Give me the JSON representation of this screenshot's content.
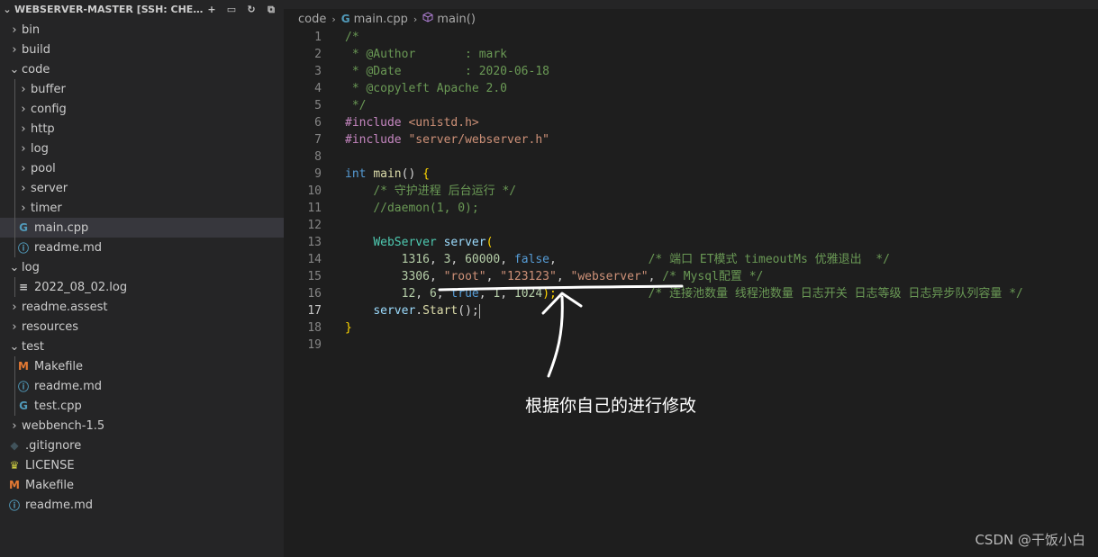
{
  "explorer": {
    "title": "WEBSERVER-MASTER [SSH: CHEN-VI...",
    "actions": [
      {
        "name": "new-file-icon",
        "glyph": "+"
      },
      {
        "name": "new-folder-icon",
        "glyph": "▭"
      },
      {
        "name": "refresh-icon",
        "glyph": "↻"
      },
      {
        "name": "collapse-all-icon",
        "glyph": "⧉"
      }
    ],
    "tree": [
      {
        "label": "bin",
        "type": "folder",
        "depth": 0,
        "expanded": false
      },
      {
        "label": "build",
        "type": "folder",
        "depth": 0,
        "expanded": false
      },
      {
        "label": "code",
        "type": "folder",
        "depth": 0,
        "expanded": true
      },
      {
        "label": "buffer",
        "type": "folder",
        "depth": 1,
        "expanded": false
      },
      {
        "label": "config",
        "type": "folder",
        "depth": 1,
        "expanded": false
      },
      {
        "label": "http",
        "type": "folder",
        "depth": 1,
        "expanded": false
      },
      {
        "label": "log",
        "type": "folder",
        "depth": 1,
        "expanded": false
      },
      {
        "label": "pool",
        "type": "folder",
        "depth": 1,
        "expanded": false
      },
      {
        "label": "server",
        "type": "folder",
        "depth": 1,
        "expanded": false
      },
      {
        "label": "timer",
        "type": "folder",
        "depth": 1,
        "expanded": false
      },
      {
        "label": "main.cpp",
        "type": "cpp",
        "depth": 1,
        "selected": true
      },
      {
        "label": "readme.md",
        "type": "info",
        "depth": 1
      },
      {
        "label": "log",
        "type": "folder",
        "depth": 0,
        "expanded": true
      },
      {
        "label": "2022_08_02.log",
        "type": "log",
        "depth": 1
      },
      {
        "label": "readme.assest",
        "type": "folder",
        "depth": 0,
        "expanded": false
      },
      {
        "label": "resources",
        "type": "folder",
        "depth": 0,
        "expanded": false
      },
      {
        "label": "test",
        "type": "folder",
        "depth": 0,
        "expanded": true
      },
      {
        "label": "Makefile",
        "type": "make",
        "depth": 1
      },
      {
        "label": "readme.md",
        "type": "info",
        "depth": 1
      },
      {
        "label": "test.cpp",
        "type": "cpp",
        "depth": 1
      },
      {
        "label": "webbench-1.5",
        "type": "folder",
        "depth": 0,
        "expanded": false
      },
      {
        "label": ".gitignore",
        "type": "git",
        "depth": 0
      },
      {
        "label": "LICENSE",
        "type": "license",
        "depth": 0
      },
      {
        "label": "Makefile",
        "type": "make",
        "depth": 0
      },
      {
        "label": "readme.md",
        "type": "info",
        "depth": 0
      }
    ]
  },
  "breadcrumb": {
    "folder": "code",
    "file": "main.cpp",
    "symbol": "main()"
  },
  "editor": {
    "active_line": 17,
    "lines": [
      [
        [
          "/*",
          "com"
        ]
      ],
      [
        [
          " * @Author       : mark",
          "com"
        ]
      ],
      [
        [
          " * @Date         : 2020-06-18",
          "com"
        ]
      ],
      [
        [
          " * @copyleft Apache 2.0",
          "com"
        ]
      ],
      [
        [
          " */",
          "com"
        ]
      ],
      [
        [
          "#include ",
          "dir"
        ],
        [
          "<unistd.h>",
          "str"
        ]
      ],
      [
        [
          "#include ",
          "dir"
        ],
        [
          "\"server/webserver.h\"",
          "str"
        ]
      ],
      [],
      [
        [
          "int",
          "kw"
        ],
        [
          " ",
          ""
        ],
        [
          "main",
          "fn"
        ],
        [
          "() ",
          ""
        ],
        [
          "{",
          "br"
        ]
      ],
      [
        [
          "    ",
          ""
        ],
        [
          "/* 守护进程 后台运行 */",
          "com"
        ]
      ],
      [
        [
          "    ",
          ""
        ],
        [
          "//daemon(1, 0);",
          "com"
        ]
      ],
      [],
      [
        [
          "    ",
          ""
        ],
        [
          "WebServer",
          "type"
        ],
        [
          " ",
          ""
        ],
        [
          "server",
          "var"
        ],
        [
          "(",
          "br"
        ]
      ],
      [
        [
          "        ",
          ""
        ],
        [
          "1316",
          "num"
        ],
        [
          ", ",
          ""
        ],
        [
          "3",
          "num"
        ],
        [
          ", ",
          ""
        ],
        [
          "60000",
          "num"
        ],
        [
          ", ",
          ""
        ],
        [
          "false",
          "kw"
        ],
        [
          ",             ",
          ""
        ],
        [
          "/* 端口 ET模式 timeoutMs 优雅退出  */",
          "com"
        ]
      ],
      [
        [
          "        ",
          ""
        ],
        [
          "3306",
          "num"
        ],
        [
          ", ",
          ""
        ],
        [
          "\"root\"",
          "str"
        ],
        [
          ", ",
          ""
        ],
        [
          "\"123123\"",
          "str"
        ],
        [
          ", ",
          ""
        ],
        [
          "\"webserver\"",
          "str"
        ],
        [
          ", ",
          ""
        ],
        [
          "/* Mysql配置 */",
          "com"
        ]
      ],
      [
        [
          "        ",
          ""
        ],
        [
          "12",
          "num"
        ],
        [
          ", ",
          ""
        ],
        [
          "6",
          "num"
        ],
        [
          ", ",
          ""
        ],
        [
          "true",
          "kw"
        ],
        [
          ", ",
          ""
        ],
        [
          "1",
          "num"
        ],
        [
          ", ",
          ""
        ],
        [
          "1024",
          "num"
        ],
        [
          ");",
          "br"
        ],
        [
          "             ",
          ""
        ],
        [
          "/* 连接池数量 线程池数量 日志开关 日志等级 日志异步队列容量 */",
          "com"
        ]
      ],
      [
        [
          "    ",
          ""
        ],
        [
          "server",
          "var"
        ],
        [
          ".",
          ""
        ],
        [
          "Start",
          "fn"
        ],
        [
          "();",
          ""
        ]
      ],
      [
        [
          "}",
          "br"
        ]
      ],
      []
    ]
  },
  "annotation": {
    "text": "根据你自己的进行修改"
  },
  "watermark": "CSDN @干饭小白",
  "colors": {
    "sidebar_bg": "#252526",
    "editor_bg": "#1e1e1e",
    "selected_row": "#37373d",
    "comment": "#6a9955",
    "string": "#ce9178",
    "keyword": "#569cd6"
  }
}
